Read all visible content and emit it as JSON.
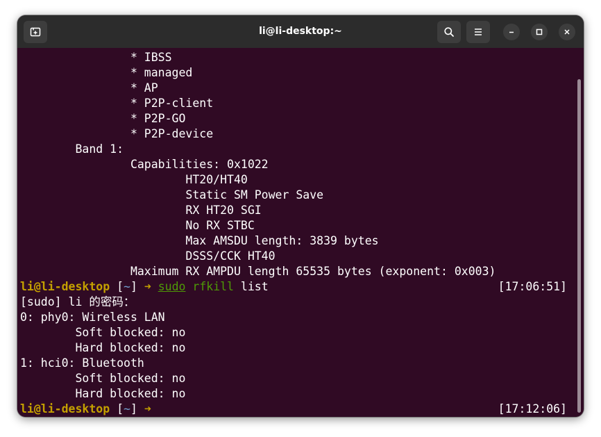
{
  "window": {
    "title": "li@li-desktop:~",
    "buttons": {
      "new_tab": "new-tab-icon",
      "search": "search-icon",
      "menu": "hamburger-menu-icon",
      "minimize": "minimize-icon",
      "maximize": "maximize-icon",
      "close": "close-icon"
    }
  },
  "terminal": {
    "output_top": [
      "                * IBSS",
      "                * managed",
      "                * AP",
      "                * P2P-client",
      "                * P2P-GO",
      "                * P2P-device",
      "        Band 1:",
      "                Capabilities: 0x1022",
      "                        HT20/HT40",
      "                        Static SM Power Save",
      "                        RX HT20 SGI",
      "                        No RX STBC",
      "                        Max AMSDU length: 3839 bytes",
      "                        DSSS/CCK HT40",
      "                Maximum RX AMPDU length 65535 bytes (exponent: 0x003)"
    ],
    "prompt1": {
      "user": "li@li-desktop",
      "open_bracket": " [",
      "path": "~",
      "close_bracket": "] ",
      "arrow": "➜",
      "sudo": "sudo",
      "cmd": "rfkill",
      "args": " list",
      "timestamp": "[17:06:51]"
    },
    "output_bottom": [
      "[sudo] li 的密码：",
      "0: phy0: Wireless LAN",
      "        Soft blocked: no",
      "        Hard blocked: no",
      "1: hci0: Bluetooth",
      "        Soft blocked: no",
      "        Hard blocked: no"
    ],
    "prompt2": {
      "user": "li@li-desktop",
      "open_bracket": " [",
      "path": "~",
      "close_bracket": "] ",
      "arrow": "➜",
      "timestamp": "[17:12:06]"
    }
  },
  "colors": {
    "terminal_bg": "#300a24",
    "titlebar_bg": "#2c2c2c",
    "user": "#c4a000",
    "path": "#729fcf",
    "command": "#4e9a06"
  }
}
